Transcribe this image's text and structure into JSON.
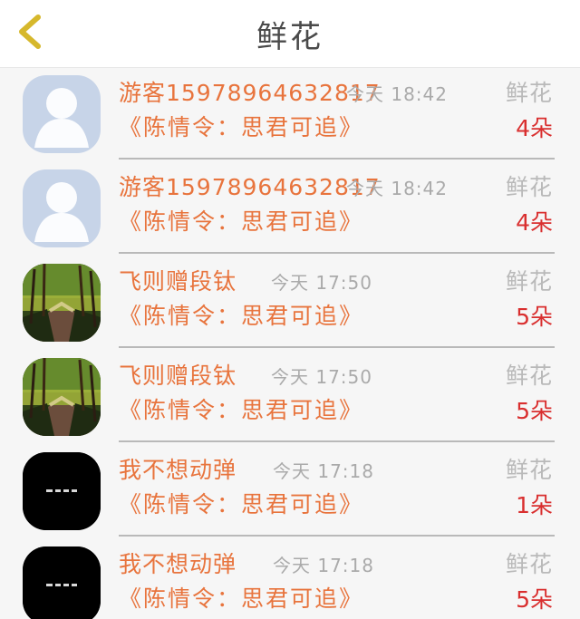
{
  "header": {
    "title": "鲜花"
  },
  "rows": [
    {
      "avatar": "default-user-avatar",
      "name": "游客15978964632817",
      "time": "今天 18:42",
      "book": "《陈情令：思君可追》",
      "gift_label": "鲜花",
      "gift_count": "4朵"
    },
    {
      "avatar": "default-user-avatar",
      "name": "游客15978964632817",
      "time": "今天 18:42",
      "book": "《陈情令：思君可追》",
      "gift_label": "鲜花",
      "gift_count": "4朵"
    },
    {
      "avatar": "forest-road-avatar",
      "name": "飞则赠段钛",
      "time": "今天 17:50",
      "book": "《陈情令：思君可追》",
      "gift_label": "鲜花",
      "gift_count": "5朵"
    },
    {
      "avatar": "forest-road-avatar",
      "name": "飞则赠段钛",
      "time": "今天 17:50",
      "book": "《陈情令：思君可追》",
      "gift_label": "鲜花",
      "gift_count": "5朵"
    },
    {
      "avatar": "black-text-avatar",
      "name": "我不想动弹",
      "time": "今天 17:18",
      "book": "《陈情令：思君可追》",
      "gift_label": "鲜花",
      "gift_count": "1朵"
    },
    {
      "avatar": "black-text-avatar",
      "name": "我不想动弹",
      "time": "今天 17:18",
      "book": "《陈情令：思君可追》",
      "gift_label": "鲜花",
      "gift_count": "5朵"
    }
  ],
  "colors": {
    "accent": "#e8743d",
    "count": "#d92f2f",
    "muted": "#aaaaaa",
    "back": "#d6b82c"
  },
  "icons": {
    "back": "chevron-left-icon"
  }
}
